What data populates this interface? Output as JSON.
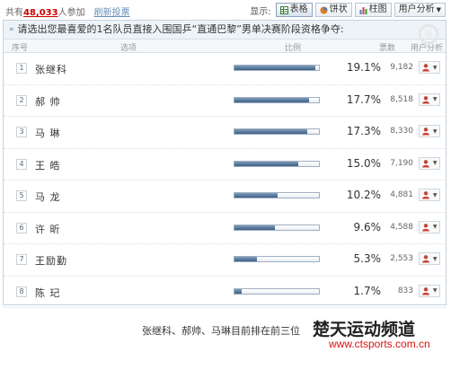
{
  "summary": {
    "prefix": "共有",
    "count": "48,033",
    "suffix": "人参加",
    "link": "刷新投票"
  },
  "view": {
    "label": "显示:",
    "buttons": [
      {
        "label": "表格",
        "icon": "table-icon"
      },
      {
        "label": "饼状",
        "icon": "pie-icon"
      },
      {
        "label": "柱图",
        "icon": "bar-chart-icon"
      },
      {
        "label": "用户分析",
        "icon": "chevron-down-icon"
      }
    ]
  },
  "question": "请选出您最喜爱的1名队员直接入围国乒“直通巴黎”男单决赛阶段资格争夺:",
  "columns": {
    "rank": "序号",
    "option": "选项",
    "ratio": "比例",
    "votes": "票数",
    "analysis": "用户分析"
  },
  "rows": [
    {
      "rank": "1",
      "name": "张继科",
      "pct": "19.1%",
      "pct_value": 19.1,
      "votes": "9,182"
    },
    {
      "rank": "2",
      "name": "郝 帅",
      "pct": "17.7%",
      "pct_value": 17.7,
      "votes": "8,518"
    },
    {
      "rank": "3",
      "name": "马 琳",
      "pct": "17.3%",
      "pct_value": 17.3,
      "votes": "8,330"
    },
    {
      "rank": "4",
      "name": "王 皓",
      "pct": "15.0%",
      "pct_value": 15.0,
      "votes": "7,190"
    },
    {
      "rank": "5",
      "name": "马 龙",
      "pct": "10.2%",
      "pct_value": 10.2,
      "votes": "4,881"
    },
    {
      "rank": "6",
      "name": "许 昕",
      "pct": "9.6%",
      "pct_value": 9.6,
      "votes": "4,588"
    },
    {
      "rank": "7",
      "name": "王励勤",
      "pct": "5.3%",
      "pct_value": 5.3,
      "votes": "2,553"
    },
    {
      "rank": "8",
      "name": "陈 玘",
      "pct": "1.7%",
      "pct_value": 1.7,
      "votes": "833"
    }
  ],
  "caption": "张继科、郝帅、马琳目前排在前三位",
  "brand": {
    "title": "楚天运动频道",
    "site": "www.ctsports.com.cn"
  },
  "colors": {
    "accent_red": "#cc0000",
    "bar_fill": "#3f5f86",
    "frame": "#c5d3e0"
  }
}
